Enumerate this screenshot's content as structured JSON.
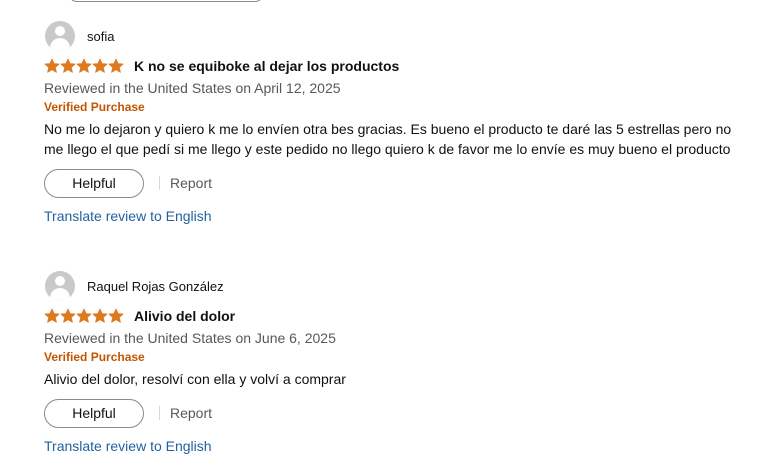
{
  "colors": {
    "star": "#de7921",
    "verified": "#c45500",
    "link": "#2162a1",
    "muted_text": "#565959",
    "text": "#0f1111"
  },
  "reviews": [
    {
      "reviewer_name": "sofia",
      "rating": 5,
      "max_rating": 5,
      "title": "K no se equiboke al dejar los productos",
      "date_line": "Reviewed in the United States on April 12, 2025",
      "verified_label": "Verified Purchase",
      "body": "No me lo dejaron y quiero k me lo envíen otra bes gracias. Es bueno el producto te daré las 5 estrellas pero no me llego el que pedí si me llego y este pedido no llego quiero k de favor me lo envíe es muy bueno el producto",
      "helpful_label": "Helpful",
      "report_label": "Report",
      "translate_label": "Translate review to English"
    },
    {
      "reviewer_name": "Raquel Rojas González",
      "rating": 5,
      "max_rating": 5,
      "title": "Alivio del dolor",
      "date_line": "Reviewed in the United States on June 6, 2025",
      "verified_label": "Verified Purchase",
      "body": "Alivio del dolor, resolví con ella y volví a comprar",
      "helpful_label": "Helpful",
      "report_label": "Report",
      "translate_label": "Translate review to English"
    }
  ]
}
